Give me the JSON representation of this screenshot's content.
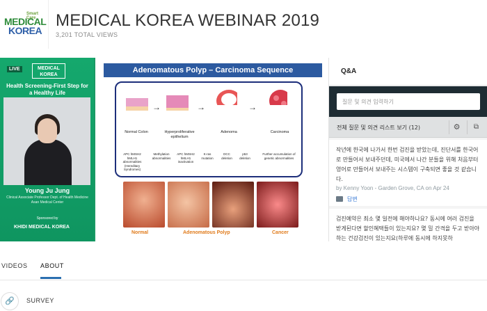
{
  "header": {
    "logo": {
      "tagline": "Smart Care",
      "word1": "MEDICAL",
      "word2": "KOREA"
    },
    "title": "MEDICAL KOREA WEBINAR 2019",
    "views": "3,201 TOTAL VIEWS"
  },
  "video": {
    "live_badge": "LIVE",
    "logo": "MEDICAL KOREA",
    "headline": "Health Screening-First Step for a Healthy Life",
    "speaker_name": "Young Ju Jung",
    "speaker_role": "Clinical Associate Professor Dept. of Health Medicine Asan Medical Center",
    "sponsor_label": "Sponsored by",
    "sponsor_logos": "KHIDI   MEDICAL KOREA",
    "slide": {
      "title": "Adenomatous Polyp – Carcinoma Sequence",
      "stages": [
        "Normal Colon",
        "Hyperproliferative epithelium",
        "Adenoma",
        "Carcinoma"
      ],
      "genes": [
        "APC hMSH2 hMLH1 abnormalities (Hereditary Syndromes)",
        "Methylation abnormalities",
        "APC hMSH2 hMLH1 inactivation",
        "K-ras mutation",
        "DCC deletion",
        "p53 deletion",
        "Further accumulation of genetic abnormalities"
      ],
      "photo_labels": [
        "Normal",
        "Adenomatous Polyp",
        "Cancer"
      ]
    }
  },
  "qa": {
    "tab_label": "Q&A",
    "input_placeholder": "질문 및 의견 입력하기",
    "list_label": "전체 질문 및 의견 리스트 보기 (12)",
    "questions": [
      {
        "text": "작년에 한국에 나가서 한번 검진을 받았는데, 진단서를 한국어로 만들어서 보내주던데, 미국에서 나간 분들을 위해 처음부터 영어로 만들어서 보내주는 시스템이 구축되면 좋을 것 같습니다.",
        "meta": "by Kenny Yoon - Garden Grove, CA on Apr 24",
        "reply": "답변"
      },
      {
        "text": "검진예약은 최소 몇 일전에 해야하나요? 동시에 여러 검진을 받게된다면 할인혜택들이 있는지요? 몇 밀 간격을 두고 받아야하는 건강검진이 있는지요(하루에 동시에 하지못하"
      }
    ]
  },
  "tabs": {
    "videos": "VIDEOS",
    "about": "ABOUT"
  },
  "survey": {
    "label": "SURVEY"
  }
}
